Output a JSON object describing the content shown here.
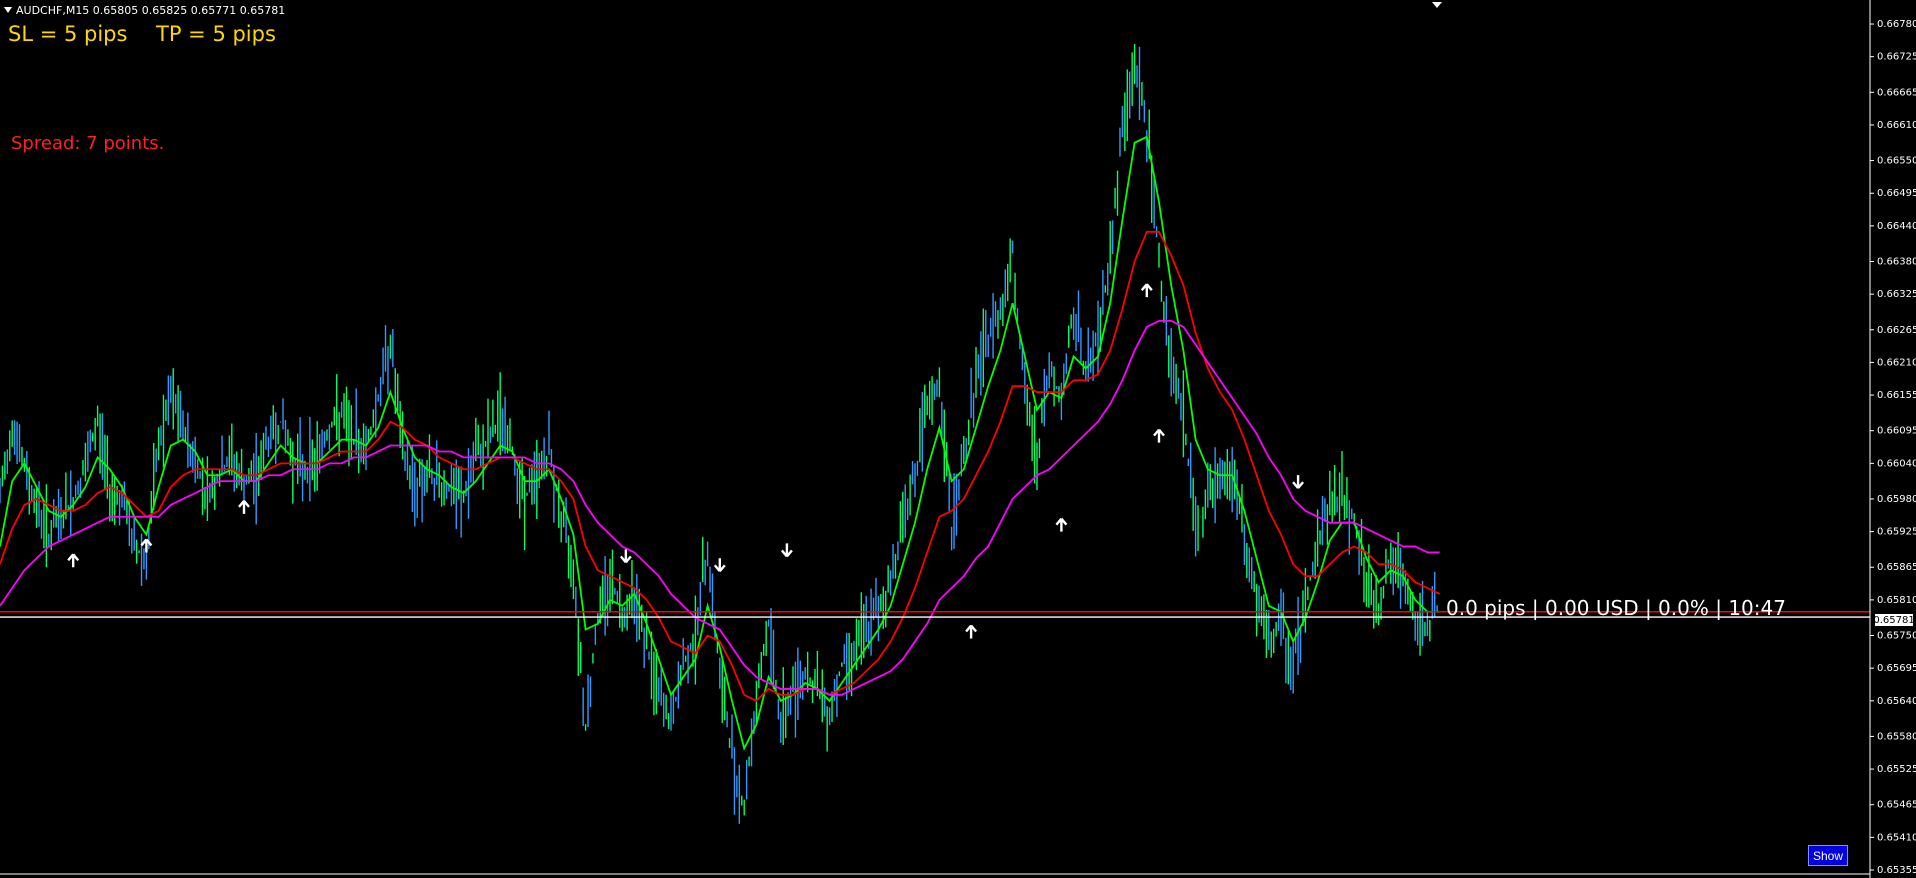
{
  "symbol": {
    "text": "AUDCHF,M15  0.65805 0.65825 0.65771 0.65781"
  },
  "sl_label": "SL = 5 pips",
  "tp_label": "TP = 5 pips",
  "spread_label": "Spread: 7 points.",
  "pnl_label": "0.0 pips | 0.00 USD | 0.0% | 10:47",
  "show_label": "Show",
  "current_price": "0.65781",
  "colors": {
    "background": "#000000",
    "candles_bull": "#00ff66",
    "candles_bear": "#3399ff",
    "ma_fast": "#00ff00",
    "ma_mid": "#ff0000",
    "ma_slow": "#ff00ff",
    "level_red": "#ff0000",
    "level_white": "#ffffff"
  },
  "chart_data": {
    "type": "line",
    "title": "",
    "xlabel": "",
    "ylabel": "",
    "ylim": [
      0.65355,
      0.66807
    ],
    "y_ticks": [
      "0.66780",
      "0.66725",
      "0.66665",
      "0.66610",
      "0.66550",
      "0.66495",
      "0.66440",
      "0.66380",
      "0.66325",
      "0.66265",
      "0.66210",
      "0.66155",
      "0.66095",
      "0.66040",
      "0.65980",
      "0.65925",
      "0.65865",
      "0.65810",
      "0.65750",
      "0.65695",
      "0.65640",
      "0.65580",
      "0.65525",
      "0.65465",
      "0.65410",
      "0.65355"
    ],
    "x": [
      0,
      10,
      20,
      30,
      40,
      50,
      60,
      70,
      80,
      90,
      100,
      110,
      120,
      130,
      140,
      150,
      160,
      170,
      180,
      190,
      200,
      210,
      220,
      230,
      240,
      250,
      260,
      270,
      280,
      290,
      300,
      310,
      320,
      330,
      340,
      350,
      360,
      370,
      380,
      390,
      400,
      410,
      420,
      430,
      440,
      450,
      460,
      470,
      480,
      490,
      500,
      510,
      520,
      530,
      540,
      550,
      560,
      570,
      580,
      590,
      600,
      610,
      620,
      630,
      640,
      650,
      660,
      670,
      680,
      690,
      700,
      710,
      720,
      730,
      740,
      750,
      760,
      770,
      780,
      790,
      800,
      810,
      820,
      830,
      840,
      850,
      860,
      870,
      880,
      890,
      900,
      910,
      920,
      930,
      940,
      950,
      960,
      970,
      980,
      990,
      1000,
      1010,
      1020,
      1030,
      1040,
      1050,
      1060,
      1070,
      1080,
      1090,
      1100,
      1110,
      1120,
      1130,
      1140,
      1150,
      1160,
      1170,
      1180
    ],
    "series": [
      {
        "name": "",
        "role": "price",
        "values": [
          0.6598,
          0.6611,
          0.6603,
          0.6597,
          0.6592,
          0.6595,
          0.6598,
          0.6603,
          0.6611,
          0.66,
          0.6598,
          0.659,
          0.6588,
          0.6607,
          0.6615,
          0.661,
          0.6604,
          0.6599,
          0.6602,
          0.6605,
          0.66,
          0.6602,
          0.6608,
          0.6611,
          0.6605,
          0.6603,
          0.6605,
          0.661,
          0.6612,
          0.6608,
          0.6607,
          0.6615,
          0.6625,
          0.6606,
          0.66,
          0.6602,
          0.6601,
          0.6599,
          0.6598,
          0.6605,
          0.6608,
          0.6612,
          0.6606,
          0.6598,
          0.6602,
          0.6606,
          0.6595,
          0.6587,
          0.656,
          0.6578,
          0.6585,
          0.6579,
          0.6583,
          0.6573,
          0.6565,
          0.656,
          0.657,
          0.6575,
          0.659,
          0.6568,
          0.6555,
          0.6546,
          0.6565,
          0.6577,
          0.656,
          0.6566,
          0.6569,
          0.6566,
          0.6562,
          0.657,
          0.6573,
          0.6576,
          0.6579,
          0.6584,
          0.6595,
          0.6602,
          0.6613,
          0.6617,
          0.6593,
          0.6605,
          0.6618,
          0.6625,
          0.663,
          0.664,
          0.6615,
          0.6605,
          0.662,
          0.6615,
          0.663,
          0.6619,
          0.6625,
          0.664,
          0.666,
          0.6672,
          0.666,
          0.6638,
          0.6621,
          0.6612,
          0.6593,
          0.6598,
          0.6601,
          0.6603,
          0.6591,
          0.6581,
          0.6573,
          0.6577,
          0.657,
          0.6581,
          0.659,
          0.6598,
          0.6598,
          0.6595,
          0.6583,
          0.658,
          0.6588,
          0.6584,
          0.6577,
          0.6577,
          0.658
        ]
      },
      {
        "name": "",
        "role": "ma_fast",
        "values": [
          0.659,
          0.6601,
          0.6604,
          0.66,
          0.6596,
          0.6595,
          0.6597,
          0.66,
          0.6605,
          0.6603,
          0.66,
          0.6595,
          0.6592,
          0.66,
          0.6607,
          0.6608,
          0.6606,
          0.6602,
          0.6602,
          0.6603,
          0.6601,
          0.6601,
          0.6604,
          0.6607,
          0.6605,
          0.6604,
          0.6604,
          0.6606,
          0.6608,
          0.6608,
          0.6607,
          0.661,
          0.6616,
          0.661,
          0.6605,
          0.6603,
          0.6602,
          0.66,
          0.6599,
          0.6601,
          0.6604,
          0.6607,
          0.6606,
          0.6601,
          0.6601,
          0.6603,
          0.6598,
          0.6592,
          0.6576,
          0.6577,
          0.6581,
          0.658,
          0.6582,
          0.6577,
          0.6571,
          0.6565,
          0.6568,
          0.6571,
          0.658,
          0.6573,
          0.6564,
          0.6556,
          0.656,
          0.6568,
          0.6564,
          0.6565,
          0.6567,
          0.6566,
          0.6564,
          0.6567,
          0.657,
          0.6573,
          0.6576,
          0.658,
          0.6587,
          0.6594,
          0.6603,
          0.661,
          0.6601,
          0.6603,
          0.661,
          0.6617,
          0.6623,
          0.6631,
          0.6622,
          0.6613,
          0.6616,
          0.6615,
          0.6622,
          0.662,
          0.6622,
          0.6631,
          0.6645,
          0.6658,
          0.6659,
          0.6648,
          0.6634,
          0.6623,
          0.6608,
          0.6603,
          0.6602,
          0.6602,
          0.6596,
          0.6588,
          0.658,
          0.6579,
          0.6574,
          0.6578,
          0.6584,
          0.6591,
          0.6594,
          0.6594,
          0.6588,
          0.6584,
          0.6586,
          0.6585,
          0.6581,
          0.6579,
          0.6579
        ]
      },
      {
        "name": "",
        "role": "ma_mid",
        "values": [
          0.6587,
          0.6593,
          0.6597,
          0.6598,
          0.6597,
          0.6596,
          0.6596,
          0.6597,
          0.6599,
          0.66,
          0.6599,
          0.6597,
          0.6595,
          0.6596,
          0.66,
          0.6602,
          0.6603,
          0.6603,
          0.6603,
          0.6603,
          0.6602,
          0.6602,
          0.6603,
          0.6604,
          0.6604,
          0.6604,
          0.6604,
          0.6605,
          0.6606,
          0.6606,
          0.6606,
          0.6608,
          0.6611,
          0.661,
          0.6608,
          0.6607,
          0.6605,
          0.6604,
          0.6603,
          0.6603,
          0.6604,
          0.6605,
          0.6605,
          0.6604,
          0.6603,
          0.6603,
          0.6601,
          0.6598,
          0.659,
          0.6586,
          0.6585,
          0.6584,
          0.6583,
          0.6581,
          0.6578,
          0.6574,
          0.6573,
          0.6572,
          0.6575,
          0.6574,
          0.657,
          0.6565,
          0.6564,
          0.6566,
          0.6565,
          0.6565,
          0.6566,
          0.6566,
          0.6565,
          0.6566,
          0.6567,
          0.6569,
          0.6571,
          0.6574,
          0.6578,
          0.6583,
          0.6589,
          0.6595,
          0.6596,
          0.6598,
          0.6602,
          0.6606,
          0.6611,
          0.6617,
          0.6617,
          0.6616,
          0.6616,
          0.6616,
          0.6618,
          0.6618,
          0.6619,
          0.6623,
          0.663,
          0.6638,
          0.6643,
          0.6643,
          0.6639,
          0.6634,
          0.6626,
          0.662,
          0.6616,
          0.6613,
          0.6608,
          0.6602,
          0.6596,
          0.6592,
          0.6587,
          0.6585,
          0.6585,
          0.6587,
          0.6589,
          0.659,
          0.6589,
          0.6587,
          0.6587,
          0.6586,
          0.6584,
          0.6583,
          0.6582
        ]
      },
      {
        "name": "",
        "role": "ma_slow",
        "values": [
          0.658,
          0.6583,
          0.6586,
          0.6588,
          0.659,
          0.6591,
          0.6592,
          0.6593,
          0.6594,
          0.6595,
          0.6595,
          0.6595,
          0.6595,
          0.6595,
          0.6597,
          0.6598,
          0.6599,
          0.66,
          0.6601,
          0.6601,
          0.6601,
          0.6601,
          0.6602,
          0.6602,
          0.6603,
          0.6603,
          0.6603,
          0.6604,
          0.6604,
          0.6605,
          0.6605,
          0.6606,
          0.6607,
          0.6607,
          0.6607,
          0.6607,
          0.6606,
          0.6606,
          0.6605,
          0.6605,
          0.6605,
          0.6605,
          0.6605,
          0.6605,
          0.6604,
          0.6604,
          0.6603,
          0.6601,
          0.6597,
          0.6594,
          0.6592,
          0.659,
          0.6589,
          0.6587,
          0.6585,
          0.6582,
          0.658,
          0.6578,
          0.6577,
          0.6576,
          0.6573,
          0.657,
          0.6568,
          0.6567,
          0.6566,
          0.6566,
          0.6566,
          0.6566,
          0.6565,
          0.6565,
          0.6566,
          0.6567,
          0.6568,
          0.6569,
          0.6571,
          0.6574,
          0.6577,
          0.6581,
          0.6583,
          0.6585,
          0.6588,
          0.659,
          0.6594,
          0.6598,
          0.66,
          0.6602,
          0.6603,
          0.6605,
          0.6607,
          0.6609,
          0.6611,
          0.6614,
          0.6618,
          0.6623,
          0.6627,
          0.6628,
          0.6628,
          0.6627,
          0.6624,
          0.6621,
          0.6618,
          0.6615,
          0.6612,
          0.6609,
          0.6605,
          0.6602,
          0.6598,
          0.6596,
          0.6595,
          0.6594,
          0.6594,
          0.6594,
          0.6593,
          0.6592,
          0.6591,
          0.659,
          0.659,
          0.6589,
          0.6589
        ]
      }
    ],
    "arrows": [
      {
        "x": 60,
        "dir": "up",
        "price": 0.65875
      },
      {
        "x": 120,
        "dir": "up",
        "price": 0.659
      },
      {
        "x": 200,
        "dir": "up",
        "price": 0.65965
      },
      {
        "x": 513,
        "dir": "down",
        "price": 0.65885
      },
      {
        "x": 590,
        "dir": "down",
        "price": 0.6587
      },
      {
        "x": 645,
        "dir": "down",
        "price": 0.65895
      },
      {
        "x": 796,
        "dir": "up",
        "price": 0.65755
      },
      {
        "x": 870,
        "dir": "up",
        "price": 0.65935
      },
      {
        "x": 940,
        "dir": "up",
        "price": 0.6633
      },
      {
        "x": 950,
        "dir": "up",
        "price": 0.66085
      },
      {
        "x": 1064,
        "dir": "down",
        "price": 0.6601
      }
    ],
    "levels": [
      {
        "role": "tp",
        "price": 0.6579,
        "color": "#ff0000"
      },
      {
        "role": "current",
        "price": 0.65781,
        "color": "#ffffff"
      }
    ],
    "legend": "none",
    "grid": false
  }
}
